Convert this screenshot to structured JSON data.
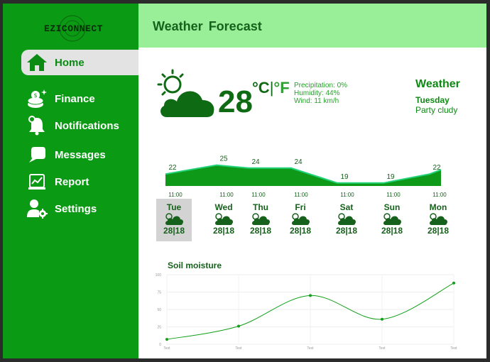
{
  "app": {
    "logo_text": "EZICONNECT"
  },
  "sidebar": {
    "items": [
      {
        "label": "Home",
        "icon": "home-icon",
        "active": true
      },
      {
        "label": "Finance",
        "icon": "coins-icon",
        "active": false
      },
      {
        "label": "Notifications",
        "icon": "bell-icon",
        "active": false
      },
      {
        "label": "Messages",
        "icon": "chat-icon",
        "active": false
      },
      {
        "label": "Report",
        "icon": "report-icon",
        "active": false
      },
      {
        "label": "Settings",
        "icon": "user-gear-icon",
        "active": false
      }
    ]
  },
  "header": {
    "title": "Weather  Forecast"
  },
  "current": {
    "temperature": "28",
    "unit_c": "°C",
    "unit_sep": "|",
    "unit_f": "°F",
    "precipitation": "Precipitation: 0%",
    "humidity": "Humidity: 44%",
    "wind": "Wind: 11 km/h",
    "icon": "partly-cloudy-icon"
  },
  "summary": {
    "title": "Weather",
    "day": "Tuesday",
    "description": "Party cludy"
  },
  "hourly": {
    "values": [
      22,
      25,
      24,
      24,
      19,
      19,
      22
    ],
    "times": [
      "11:00",
      "11:00",
      "11:00",
      "11:00",
      "11:00",
      "11:00",
      "11:00"
    ]
  },
  "days": [
    {
      "name": "Tue",
      "temp": "28|18",
      "selected": true
    },
    {
      "name": "Wed",
      "temp": "28|18",
      "selected": false
    },
    {
      "name": "Thu",
      "temp": "28|18",
      "selected": false
    },
    {
      "name": "Fri",
      "temp": "28|18",
      "selected": false
    },
    {
      "name": "Sat",
      "temp": "28|18",
      "selected": false
    },
    {
      "name": "Sun",
      "temp": "28|18",
      "selected": false
    },
    {
      "name": "Mon",
      "temp": "28|18",
      "selected": false
    }
  ],
  "colors": {
    "sidebar": "#0b9a14",
    "header": "#98ef98",
    "accent_dark": "#16611b",
    "chart_fill": "#0e9a18",
    "chart_line": "#22d37a"
  },
  "soil": {
    "title": "Soil moisture",
    "chart_data": {
      "type": "line",
      "x": [
        "Text",
        "Text",
        "Text",
        "Text",
        "Text"
      ],
      "y": [
        7,
        26,
        70,
        36,
        88
      ],
      "ylim": [
        0,
        100
      ],
      "yticks": [
        0,
        25,
        50,
        75,
        100
      ],
      "grid": true
    }
  }
}
